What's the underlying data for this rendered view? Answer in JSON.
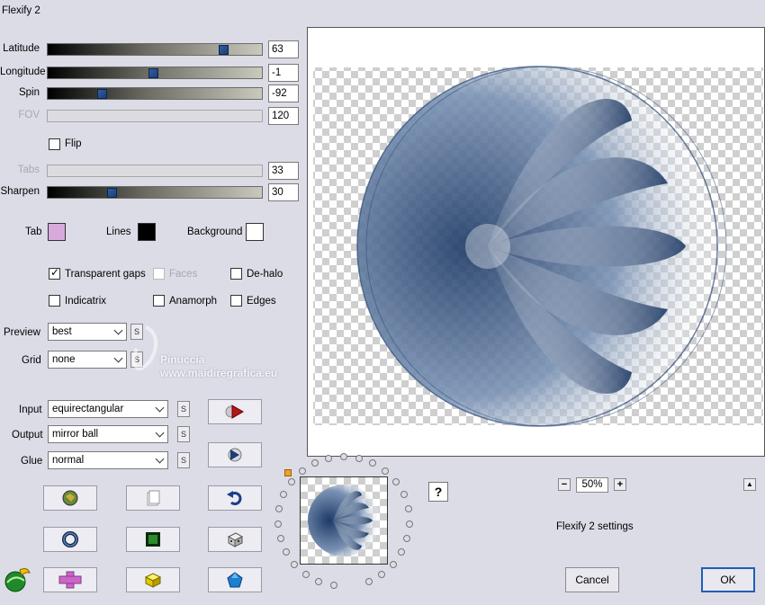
{
  "window": {
    "title": "Flexify 2"
  },
  "sliders": [
    {
      "label": "Latitude",
      "value": "63",
      "level": 0.82,
      "enabled": true
    },
    {
      "label": "Longitude",
      "value": "-1",
      "level": 0.49,
      "enabled": true
    },
    {
      "label": "Spin",
      "value": "-92",
      "level": 0.25,
      "enabled": true
    },
    {
      "label": "FOV",
      "value": "120",
      "enabled": false
    },
    {
      "label": "Tabs",
      "value": "33",
      "enabled": false
    },
    {
      "label": "Sharpen",
      "value": "30",
      "level": 0.3,
      "enabled": true
    }
  ],
  "flip": {
    "label": "Flip",
    "checked": false
  },
  "colors": {
    "tab_label": "Tab",
    "tab_color": "#d8aadc",
    "lines_label": "Lines",
    "lines_color": "#000000",
    "background_label": "Background",
    "background_color": "#ffffff",
    "accent": "#1e5fb4"
  },
  "options": [
    {
      "label": "Transparent gaps",
      "checked": true,
      "enabled": true
    },
    {
      "label": "Faces",
      "checked": false,
      "enabled": false
    },
    {
      "label": "De-halo",
      "checked": false,
      "enabled": true
    },
    {
      "label": "Indicatrix",
      "checked": false,
      "enabled": true
    },
    {
      "label": "Anamorph",
      "checked": false,
      "enabled": true
    },
    {
      "label": "Edges",
      "checked": false,
      "enabled": true
    }
  ],
  "preview_select": {
    "label": "Preview",
    "value": "best"
  },
  "grid_select": {
    "label": "Grid",
    "value": "none"
  },
  "watermark": {
    "line1": "Pinuccia",
    "line2": "www.maidiregrafica.eu"
  },
  "input_select": {
    "label": "Input",
    "value": "equirectangular"
  },
  "output_select": {
    "label": "Output",
    "value": "mirror ball"
  },
  "glue_select": {
    "label": "Glue",
    "value": "normal"
  },
  "s_label": "S",
  "zoom": {
    "minus": "−",
    "value": "50%",
    "plus": "+"
  },
  "help": "?",
  "up_arrow": "▲",
  "settings_text": "Flexify 2 settings",
  "buttons": {
    "cancel": "Cancel",
    "ok": "OK"
  },
  "icons": [
    "play-arrow-icon",
    "play-sphere-icon",
    "randomize-globe-icon",
    "copy-page-icon",
    "undo-arrow-icon",
    "ring-icon",
    "green-square-icon",
    "dice-icon",
    "pink-cross-icon",
    "yellow-cube-icon",
    "blue-gem-icon",
    "flexify-logo-icon"
  ]
}
